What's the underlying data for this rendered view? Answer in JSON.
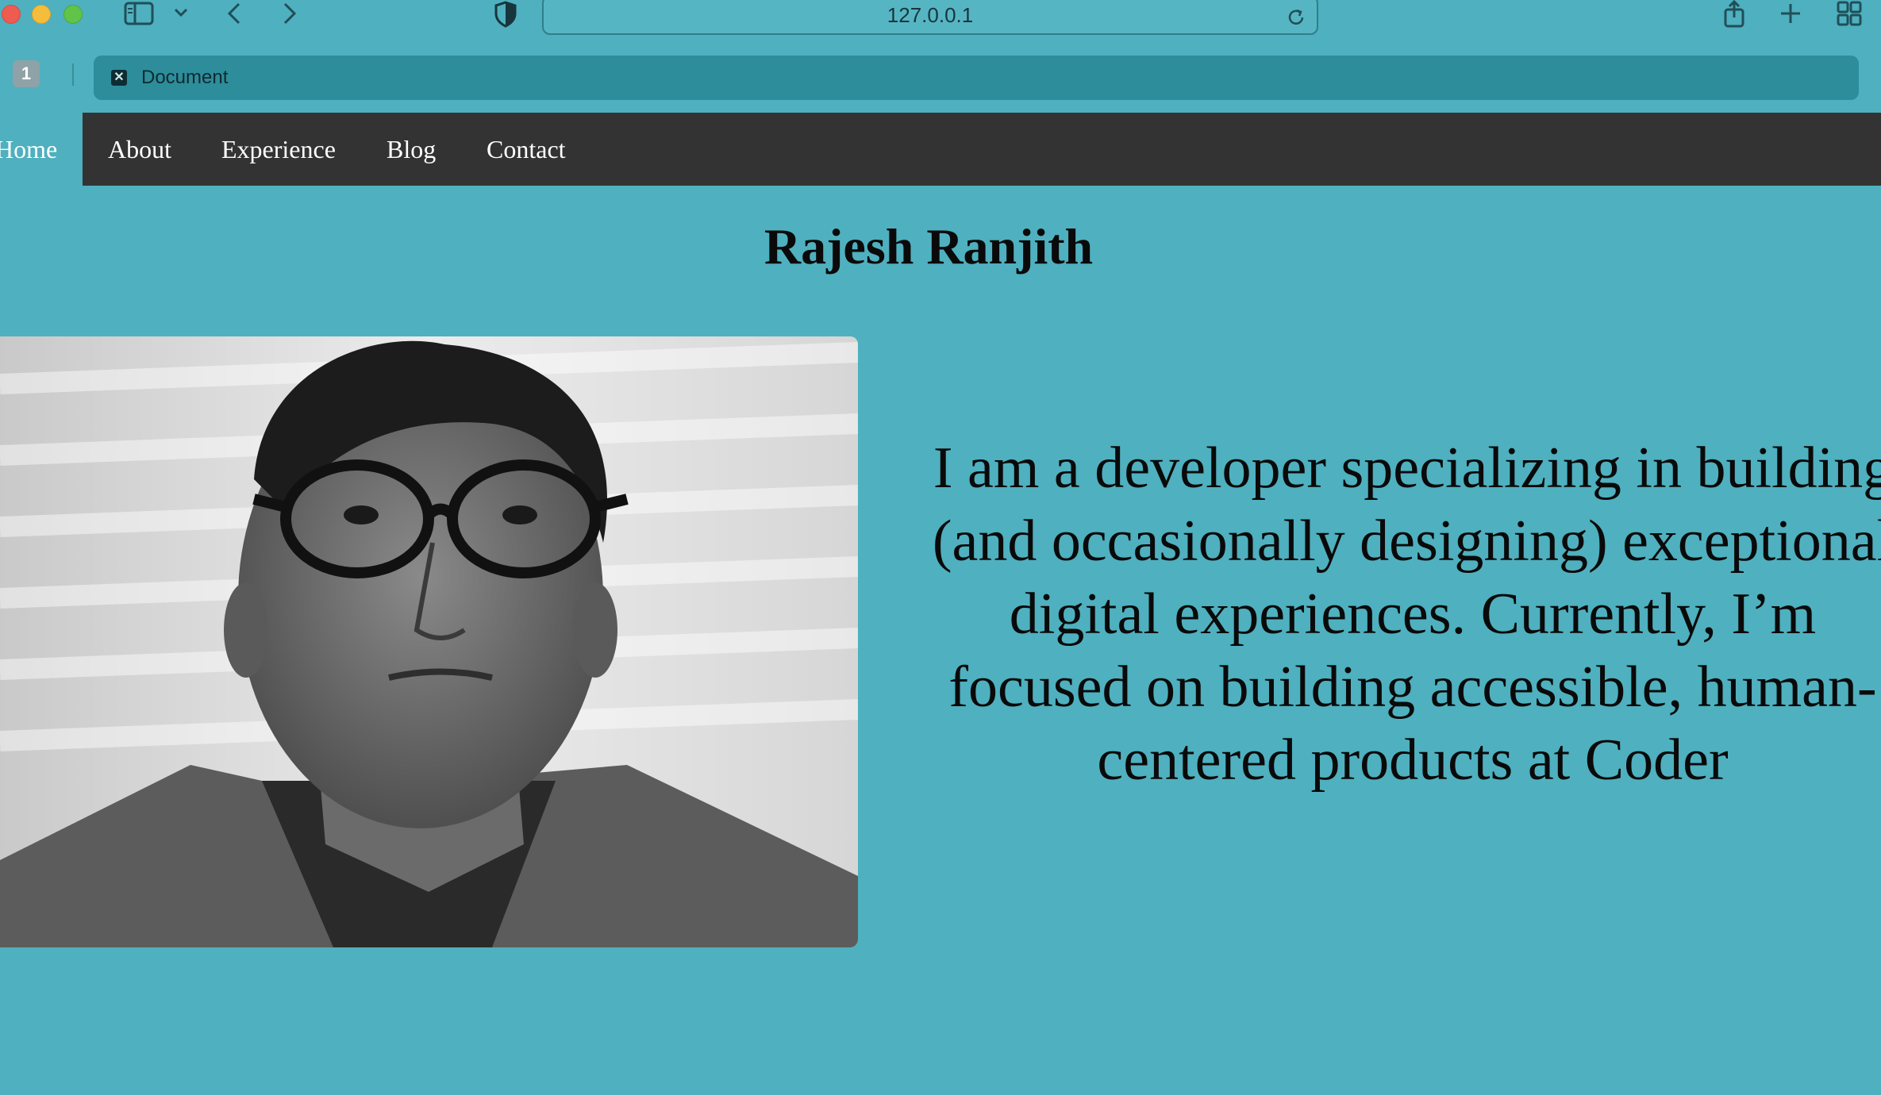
{
  "browser": {
    "url": "127.0.0.1",
    "tab_count": "1",
    "tab_title": "Document",
    "icons": [
      "sidebar-icon",
      "chevron-down-icon",
      "back-icon",
      "forward-icon",
      "shield-icon",
      "reload-icon",
      "share-icon",
      "new-tab-icon",
      "tab-overview-icon"
    ]
  },
  "nav": {
    "items": [
      {
        "label": "Home"
      },
      {
        "label": "About"
      },
      {
        "label": "Experience"
      },
      {
        "label": "Blog"
      },
      {
        "label": "Contact"
      }
    ]
  },
  "hero": {
    "name": "Rajesh Ranjith",
    "intro": "I am a developer specializing in building (and occasionally designing) exceptional digital experiences. Currently, I’m focused on building accessible, human-centered products at Coder"
  },
  "colors": {
    "page_background": "#4fb0bf",
    "nav_background": "#333333",
    "nav_text": "#ffffff",
    "tab_background": "#2d8d9b"
  }
}
